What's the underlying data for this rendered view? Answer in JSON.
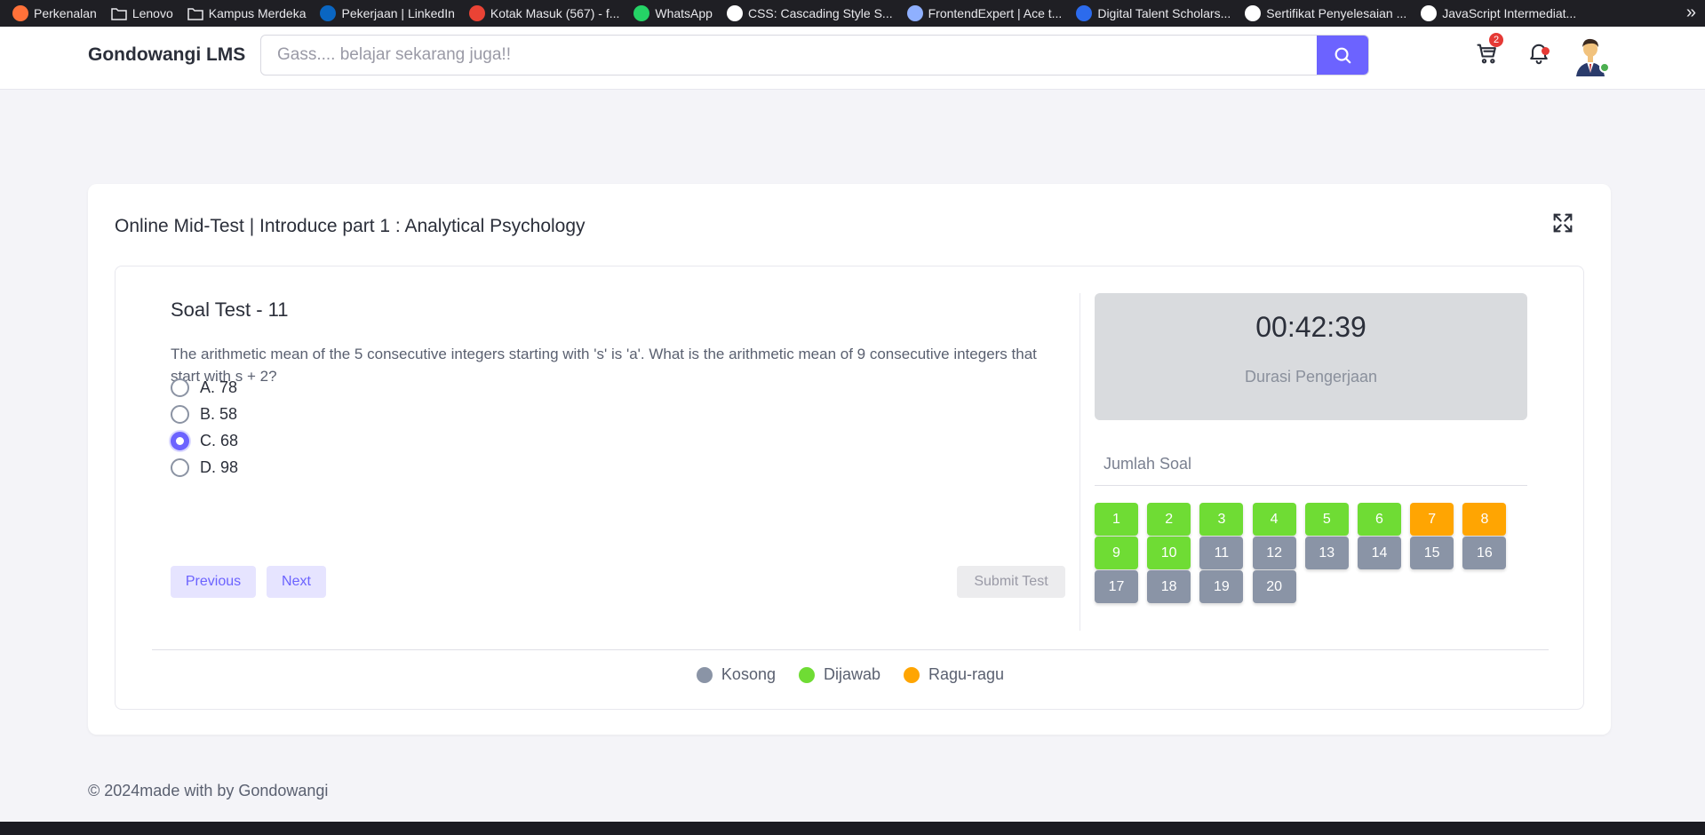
{
  "bookmarks": [
    {
      "label": "Perkenalan",
      "icon": "firefox-icon",
      "color": "#ff7139"
    },
    {
      "label": "Lenovo",
      "icon": "folder-icon",
      "color": ""
    },
    {
      "label": "Kampus Merdeka",
      "icon": "folder-icon",
      "color": ""
    },
    {
      "label": "Pekerjaan | LinkedIn",
      "icon": "linkedin-icon",
      "color": "#0a66c2"
    },
    {
      "label": "Kotak Masuk (567) - f...",
      "icon": "gmail-icon",
      "color": "#ea4335"
    },
    {
      "label": "WhatsApp",
      "icon": "whatsapp-icon",
      "color": "#25d366"
    },
    {
      "label": "CSS: Cascading Style S...",
      "icon": "mdn-icon",
      "color": "#ffffff"
    },
    {
      "label": "FrontendExpert | Ace t...",
      "icon": "frontendexpert-icon",
      "color": "#8fb0ff"
    },
    {
      "label": "Digital Talent Scholars...",
      "icon": "digitalent-icon",
      "color": "#2c6bed"
    },
    {
      "label": "Sertifikat Penyelesaian ...",
      "icon": "certificate-icon",
      "color": "#ffffff"
    },
    {
      "label": "JavaScript Intermediat...",
      "icon": "js-course-icon",
      "color": "#ffffff"
    }
  ],
  "header": {
    "brand": "Gondowangi LMS",
    "search_placeholder": "Gass.... belajar sekarang juga!!",
    "cart_count": "2"
  },
  "page": {
    "title": "Online Mid-Test | Introduce part 1 : Analytical Psychology"
  },
  "question": {
    "title": "Soal Test - 11",
    "text": "The arithmetic mean of the 5 consecutive integers starting with 's' is 'a'. What is the arithmetic mean of 9 consecutive integers that start with s + 2?",
    "options": [
      {
        "label": "A. 78",
        "checked": false
      },
      {
        "label": "B. 58",
        "checked": false
      },
      {
        "label": "C. 68",
        "checked": true
      },
      {
        "label": "D. 98",
        "checked": false
      }
    ],
    "prev_label": "Previous",
    "next_label": "Next",
    "submit_label": "Submit Test"
  },
  "timer": {
    "value": "00:42:39",
    "label": "Durasi Pengerjaan"
  },
  "navigator": {
    "title": "Jumlah Soal",
    "questions": [
      {
        "n": "1",
        "status": "answered"
      },
      {
        "n": "2",
        "status": "answered"
      },
      {
        "n": "3",
        "status": "answered"
      },
      {
        "n": "4",
        "status": "answered"
      },
      {
        "n": "5",
        "status": "answered"
      },
      {
        "n": "6",
        "status": "answered"
      },
      {
        "n": "7",
        "status": "doubt"
      },
      {
        "n": "8",
        "status": "doubt"
      },
      {
        "n": "9",
        "status": "answered"
      },
      {
        "n": "10",
        "status": "answered"
      },
      {
        "n": "11",
        "status": "empty"
      },
      {
        "n": "12",
        "status": "empty"
      },
      {
        "n": "13",
        "status": "empty"
      },
      {
        "n": "14",
        "status": "empty"
      },
      {
        "n": "15",
        "status": "empty"
      },
      {
        "n": "16",
        "status": "empty"
      },
      {
        "n": "17",
        "status": "empty"
      },
      {
        "n": "18",
        "status": "empty"
      },
      {
        "n": "19",
        "status": "empty"
      },
      {
        "n": "20",
        "status": "empty"
      }
    ]
  },
  "legend": [
    {
      "label": "Kosong",
      "color": "#8a94a6"
    },
    {
      "label": "Dijawab",
      "color": "#6fdc34"
    },
    {
      "label": "Ragu-ragu",
      "color": "#ffa502"
    }
  ],
  "status_colors": {
    "empty": "#8a94a6",
    "answered": "#6fdc34",
    "doubt": "#ffa502"
  },
  "footer": {
    "text": "© 2024made with by Gondowangi"
  }
}
